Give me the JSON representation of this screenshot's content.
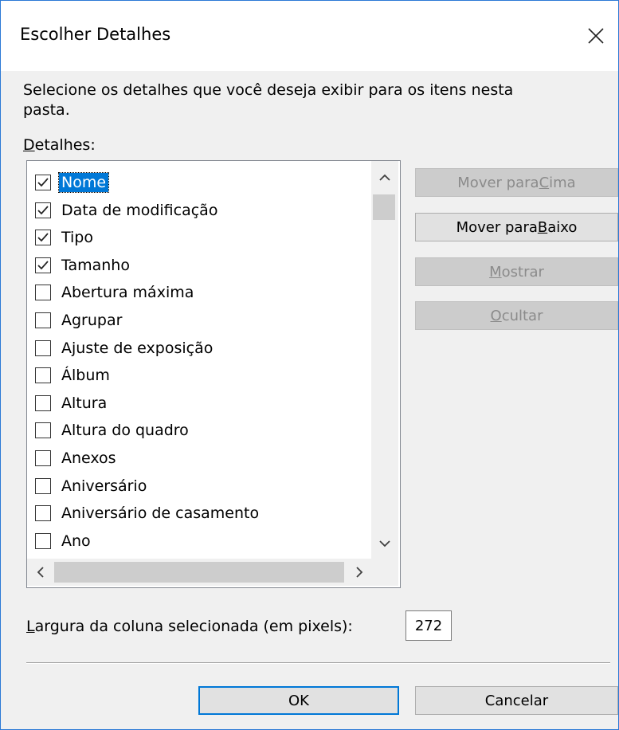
{
  "dialog": {
    "title": "Escolher Detalhes",
    "description": "Selecione os detalhes que você deseja exibir para os itens nesta pasta.",
    "details_label_underlined": "D",
    "details_label_rest": "etalhes:"
  },
  "details_list": {
    "items": [
      {
        "label": "Nome",
        "checked": true,
        "selected": true
      },
      {
        "label": "Data de modificação",
        "checked": true,
        "selected": false
      },
      {
        "label": "Tipo",
        "checked": true,
        "selected": false
      },
      {
        "label": "Tamanho",
        "checked": true,
        "selected": false
      },
      {
        "label": "Abertura máxima",
        "checked": false,
        "selected": false
      },
      {
        "label": "Agrupar",
        "checked": false,
        "selected": false
      },
      {
        "label": "Ajuste de exposição",
        "checked": false,
        "selected": false
      },
      {
        "label": "Álbum",
        "checked": false,
        "selected": false
      },
      {
        "label": "Altura",
        "checked": false,
        "selected": false
      },
      {
        "label": "Altura do quadro",
        "checked": false,
        "selected": false
      },
      {
        "label": "Anexos",
        "checked": false,
        "selected": false
      },
      {
        "label": "Aniversário",
        "checked": false,
        "selected": false
      },
      {
        "label": "Aniversário de casamento",
        "checked": false,
        "selected": false
      },
      {
        "label": "Ano",
        "checked": false,
        "selected": false
      }
    ]
  },
  "side_buttons": {
    "move_up": {
      "pre": "Mover para ",
      "u": "C",
      "post": "ima",
      "enabled": false
    },
    "move_down": {
      "pre": "Mover para ",
      "u": "B",
      "post": "aixo",
      "enabled": true
    },
    "show": {
      "pre": "",
      "u": "M",
      "post": "ostrar",
      "enabled": false
    },
    "hide": {
      "pre": "",
      "u": "O",
      "post": "cultar",
      "enabled": false
    }
  },
  "column_width": {
    "label_underlined": "L",
    "label_rest": "argura da coluna selecionada (em pixels):",
    "value": "272"
  },
  "footer": {
    "ok_label": "OK",
    "cancel_label": "Cancelar"
  },
  "icons": {
    "close": "close-icon",
    "checkmark": "checkmark-icon",
    "scroll_up": "chevron-up-icon",
    "scroll_down": "chevron-down-icon",
    "scroll_left": "chevron-left-icon",
    "scroll_right": "chevron-right-icon"
  }
}
